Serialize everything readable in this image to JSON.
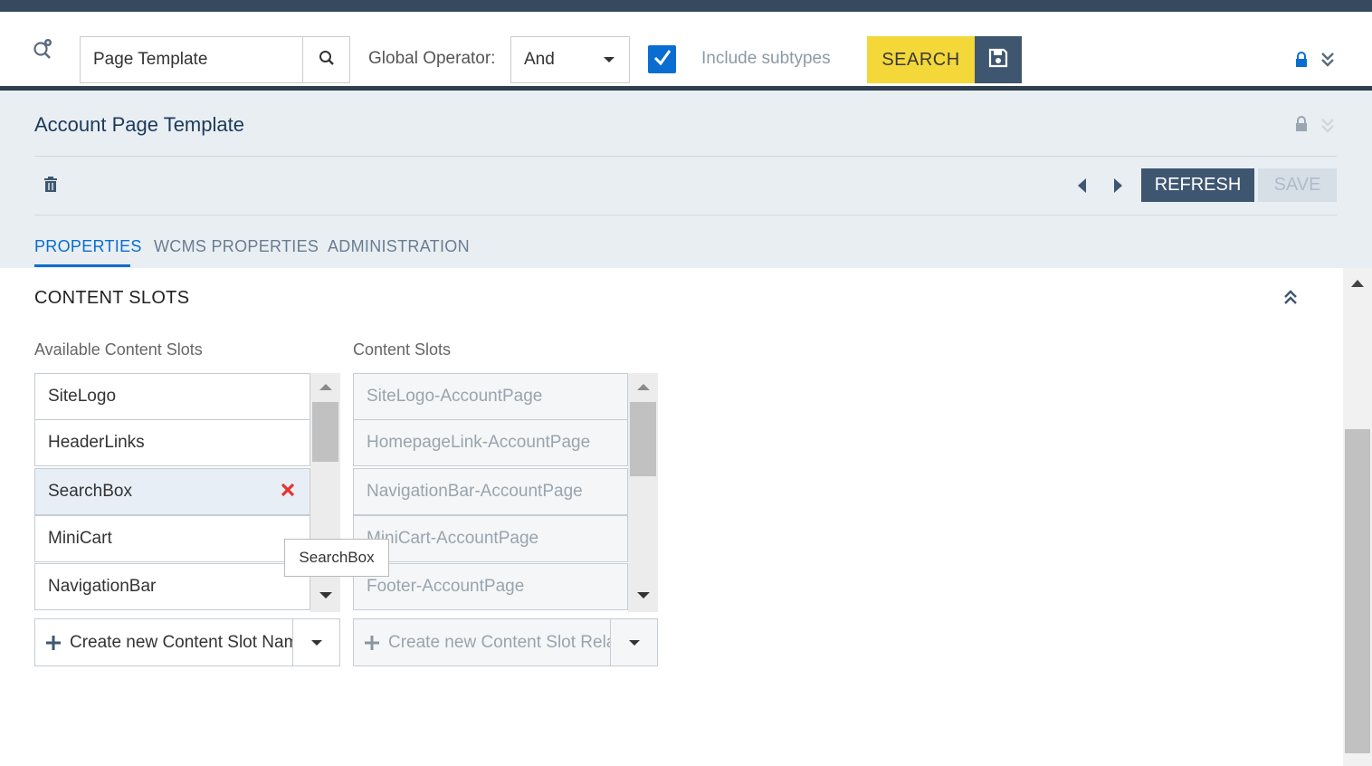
{
  "search": {
    "query": "Page Template",
    "operator_label": "Global Operator:",
    "operator_value": "And",
    "include_subtypes_label": "Include subtypes",
    "include_subtypes_checked": true,
    "search_button": "SEARCH"
  },
  "editor": {
    "title": "Account Page Template",
    "refresh_button": "REFRESH",
    "save_button": "SAVE",
    "tabs": [
      {
        "label": "PROPERTIES",
        "active": true
      },
      {
        "label": "WCMS PROPERTIES",
        "active": false
      },
      {
        "label": "ADMINISTRATION",
        "active": false
      }
    ]
  },
  "section": {
    "title": "CONTENT SLOTS",
    "available": {
      "label": "Available Content Slots",
      "items": [
        "SiteLogo",
        "HeaderLinks",
        "SearchBox",
        "MiniCart",
        "NavigationBar"
      ],
      "selected_index": 2,
      "create_label": "Create new Content Slot Nam"
    },
    "assigned": {
      "label": "Content Slots",
      "items": [
        "SiteLogo-AccountPage",
        "HomepageLink-AccountPage",
        "NavigationBar-AccountPage",
        "MiniCart-AccountPage",
        "Footer-AccountPage"
      ],
      "create_label": "Create new Content Slot Rela"
    },
    "tooltip": "SearchBox"
  },
  "colors": {
    "accent": "#0a6ed1",
    "search_button": "#f4d83a",
    "dark_button": "#3e5670",
    "remove_red": "#e8322f"
  },
  "icons": [
    "advanced-search-icon",
    "search-icon",
    "checkmark-icon",
    "save-icon",
    "lock-icon",
    "double-chevron-down-icon",
    "trash-icon",
    "arrow-left-icon",
    "arrow-right-icon",
    "double-chevron-up-icon",
    "remove-icon",
    "plus-icon"
  ]
}
